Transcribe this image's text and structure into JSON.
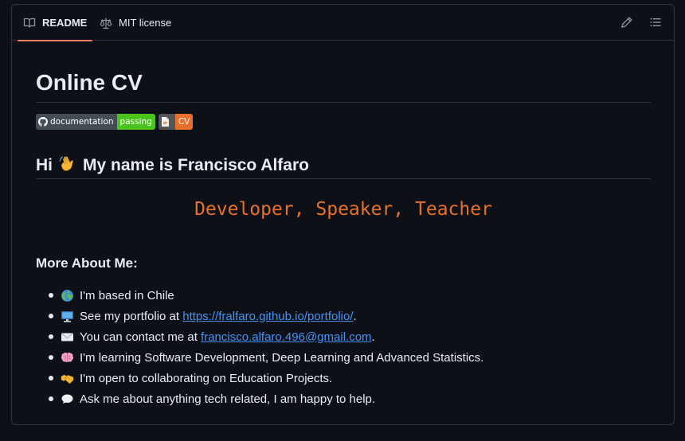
{
  "tabs": [
    {
      "label": "README",
      "icon": "book-icon",
      "active": true
    },
    {
      "label": "MIT license",
      "icon": "scale-icon",
      "active": false
    }
  ],
  "toolbar": {
    "edit_icon": "pencil-icon",
    "outline_icon": "list-icon"
  },
  "readme": {
    "title": "Online CV",
    "badges": [
      {
        "left": "documentation",
        "right": "passing",
        "right_color": "#4ac41c",
        "icon": "github-icon"
      },
      {
        "left": "",
        "right": "CV",
        "right_color": "#e8702a",
        "icon": "document-icon"
      }
    ],
    "greeting_pre": "Hi",
    "greeting_post": "My name is Francisco Alfaro",
    "typing_text": "Developer, Speaker, Teacher",
    "about_heading": "More About Me:",
    "about": {
      "based": "I'm based in Chile",
      "portfolio_pre": "See my portfolio at ",
      "portfolio_link": "https://fralfaro.github.io/portfolio/",
      "portfolio_post": ".",
      "contact_pre": "You can contact me at ",
      "contact_link": "francisco.alfaro.496@gmail.com",
      "contact_post": ".",
      "learning": "I'm learning Software Development, Deep Learning and Advanced Statistics.",
      "collab": "I'm open to collaborating on Education Projects.",
      "ask": "Ask me about anything tech related, I am happy to help."
    }
  },
  "colors": {
    "accent": "#f78166",
    "link": "#4493f8",
    "typing": "#e8702a",
    "background": "#0d1117",
    "border": "#30363d"
  }
}
